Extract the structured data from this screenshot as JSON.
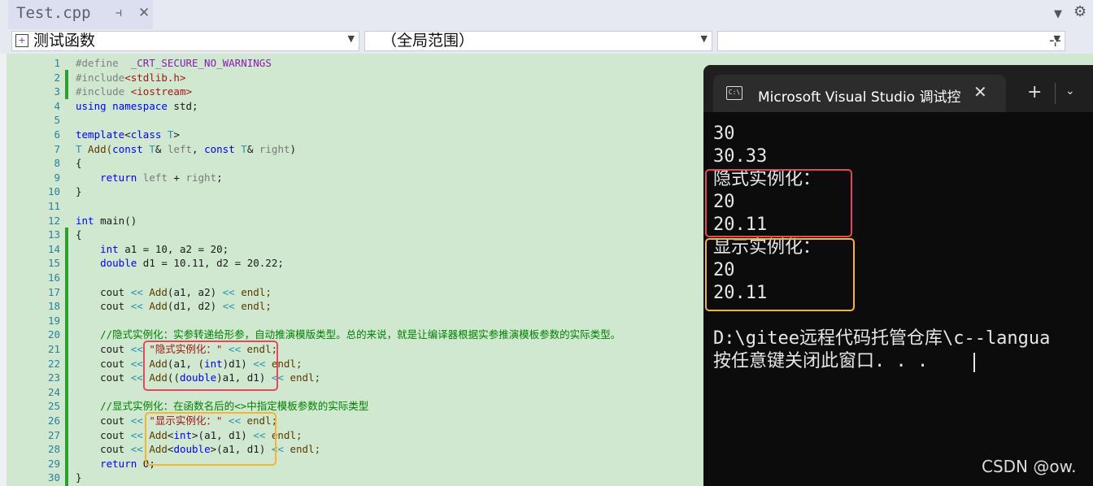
{
  "tab": {
    "title": "Test.cpp",
    "pin_icon": "pin-icon",
    "close_icon": "close-icon"
  },
  "nav": {
    "project": "测试函数",
    "scope": "（全局范围）",
    "member": ""
  },
  "gutter": {
    "lines": [
      "1",
      "2",
      "3",
      "4",
      "5",
      "6",
      "7",
      "8",
      "9",
      "10",
      "11",
      "12",
      "13",
      "14",
      "15",
      "16",
      "17",
      "18",
      "19",
      "20",
      "21",
      "22",
      "23",
      "24",
      "25",
      "26",
      "27",
      "28",
      "29",
      "30"
    ]
  },
  "code": {
    "l1_kw": "#define",
    "l1_macro": "_CRT_SECURE_NO_WARNINGS",
    "l2_kw": "#include",
    "l2_hdr": "<stdlib.h>",
    "l3_kw": "#include",
    "l3_hdr": "<iostream>",
    "l4_kw1": "using",
    "l4_kw2": "namespace",
    "l4_rest": " std;",
    "l6_kw": "template",
    "l6_p": "<",
    "l6_kw2": "class",
    "l6_t": "T",
    "l6_e": ">",
    "l7_t": "T",
    "l7_fn": " Add(",
    "l7_kw": "const",
    "l7_t2": " T",
    "l7_a": "& ",
    "l7_p1": "left",
    "l7_c": ", ",
    "l7_kw2": "const",
    "l7_t3": " T",
    "l7_b": "& ",
    "l7_p2": "right",
    "l7_e": ")",
    "l8": "{",
    "l9_kw": "return",
    "l9_p1": " left",
    "l9_op": " + ",
    "l9_p2": "right",
    "l9_e": ";",
    "l10": "}",
    "l12_kw": "int",
    "l12_rest": " main()",
    "l13": "{",
    "l14_kw": "int",
    "l14_rest": " a1 = 10, a2 = 20;",
    "l15_kw": "double",
    "l15_rest": " d1 = 10.11, d2 = 20.22;",
    "l17_a": "cout ",
    "l17_op": "<<",
    "l17_fn": " Add",
    "l17_b": "(a1, a2) ",
    "l17_op2": "<<",
    "l17_c": " endl;",
    "l18_a": "cout ",
    "l18_op": "<<",
    "l18_fn": " Add",
    "l18_b": "(d1, d2) ",
    "l18_op2": "<<",
    "l18_c": " endl;",
    "l20": "//隐式实例化：实参转递给形参，自动推演模版类型。总的来说，就是让编译器根据实参推演模板参数的实际类型。",
    "l21_a": "cout ",
    "l21_op": "<<",
    "l21_str": " \"隐式实例化：\"",
    "l21_op2": " <<",
    "l21_c": " endl;",
    "l22_a": "cout ",
    "l22_op": "<<",
    "l22_fn": " Add",
    "l22_b": "(a1, (",
    "l22_kw": "int",
    "l22_c": ")d1) ",
    "l22_op2": "<<",
    "l22_d": " endl;",
    "l23_a": "cout ",
    "l23_op": "<<",
    "l23_fn": " Add",
    "l23_b": "((",
    "l23_kw": "double",
    "l23_c": ")a1, d1) ",
    "l23_op2": "<<",
    "l23_d": " endl;",
    "l25": "//显式实例化：在函数名后的<>中指定模板参数的实际类型",
    "l26_a": "cout ",
    "l26_op": "<<",
    "l26_str": " \"显示实例化：\"",
    "l26_op2": " <<",
    "l26_c": " endl;",
    "l27_a": "cout ",
    "l27_op": "<<",
    "l27_fn": " Add",
    "l27_b": "<",
    "l27_kw": "int",
    "l27_c": ">(a1, d1) ",
    "l27_op2": "<<",
    "l27_d": " endl;",
    "l28_a": "cout ",
    "l28_op": "<<",
    "l28_fn": " Add",
    "l28_b": "<",
    "l28_kw": "double",
    "l28_c": ">(a1, d1) ",
    "l28_op2": "<<",
    "l28_d": " endl;",
    "l29_kw": "return",
    "l29_rest": " 0;",
    "l30": "}"
  },
  "terminal": {
    "title": "Microsoft Visual Studio 调试控",
    "output": [
      "30",
      "30.33",
      "隐式实例化：",
      "20",
      "20.11",
      "显示实例化：",
      "20",
      "20.11",
      "",
      "D:\\gitee远程代码托管仓库\\c--langua",
      "按任意键关闭此窗口. . ."
    ]
  },
  "watermark": "CSDN @ow.",
  "colors": {
    "editor_bg": "#cfe8cf",
    "terminal_bg": "#0c0c0c",
    "keyword": "#0000ff",
    "type": "#2b91af",
    "string": "#a31515",
    "comment": "#008000",
    "highlight_red": "#e8465a",
    "highlight_orange": "#f5b532"
  }
}
